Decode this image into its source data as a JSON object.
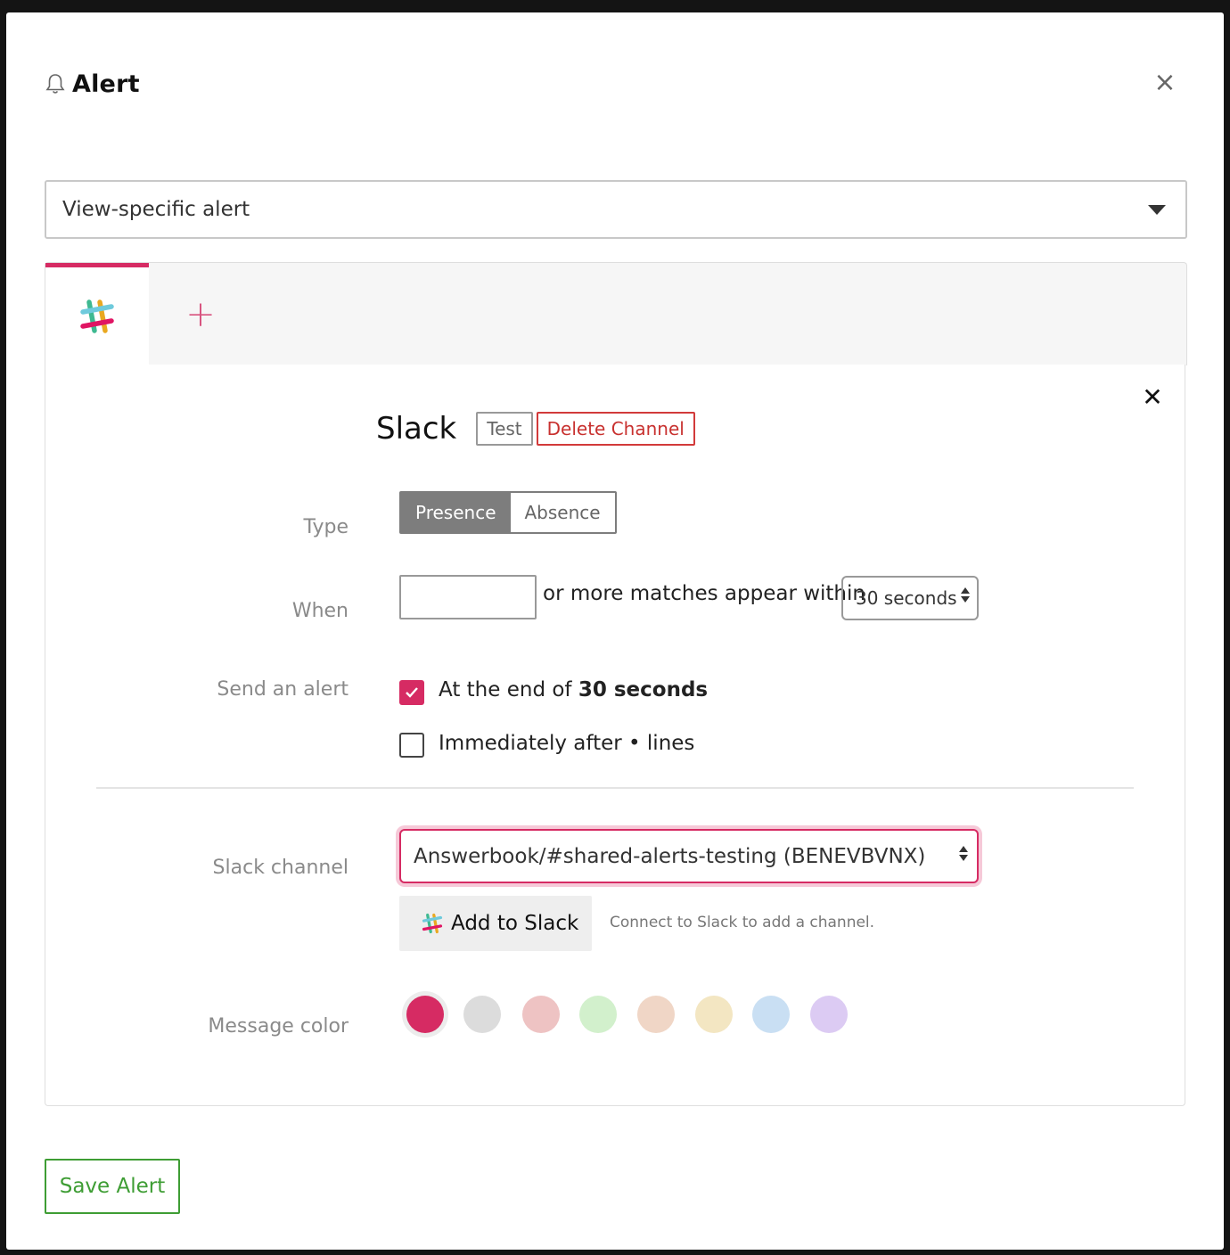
{
  "modal": {
    "title": "Alert",
    "title_icon": "bell-icon",
    "close_icon": "close-icon",
    "close_glyph": "×"
  },
  "scope": {
    "value": "View-specific alert"
  },
  "tabs": {
    "add_glyph": "+"
  },
  "channel": {
    "name": "Slack",
    "test_label": "Test",
    "delete_label": "Delete Channel",
    "close_glyph": "✕"
  },
  "form": {
    "type_label": "Type",
    "type_options": [
      "Presence",
      "Absence"
    ],
    "type_selected": "Presence",
    "when_label": "When",
    "when_value": "",
    "when_text": "or more matches appear within",
    "duration_value": "30 seconds",
    "send_label": "Send an alert",
    "end_prefix": "At the end of",
    "end_bold": "30 seconds",
    "end_checked": true,
    "immediate_text": "Immediately after • lines",
    "immediate_checked": false,
    "slack_channel_label": "Slack channel",
    "slack_channel_value": "Answerbook/#shared-alerts-testing (BENEVBVNX)",
    "add_to_slack_label": "Add to Slack",
    "connect_hint": "Connect to Slack to add a channel.",
    "message_color_label": "Message color",
    "colors": [
      "#d62b63",
      "#dcdcdc",
      "#eec3c3",
      "#d2f0cc",
      "#f0d6c6",
      "#f3e6c2",
      "#c9dff3",
      "#dccbf3"
    ],
    "selected_color": "#d62b63"
  },
  "footer": {
    "save_label": "Save Alert"
  }
}
